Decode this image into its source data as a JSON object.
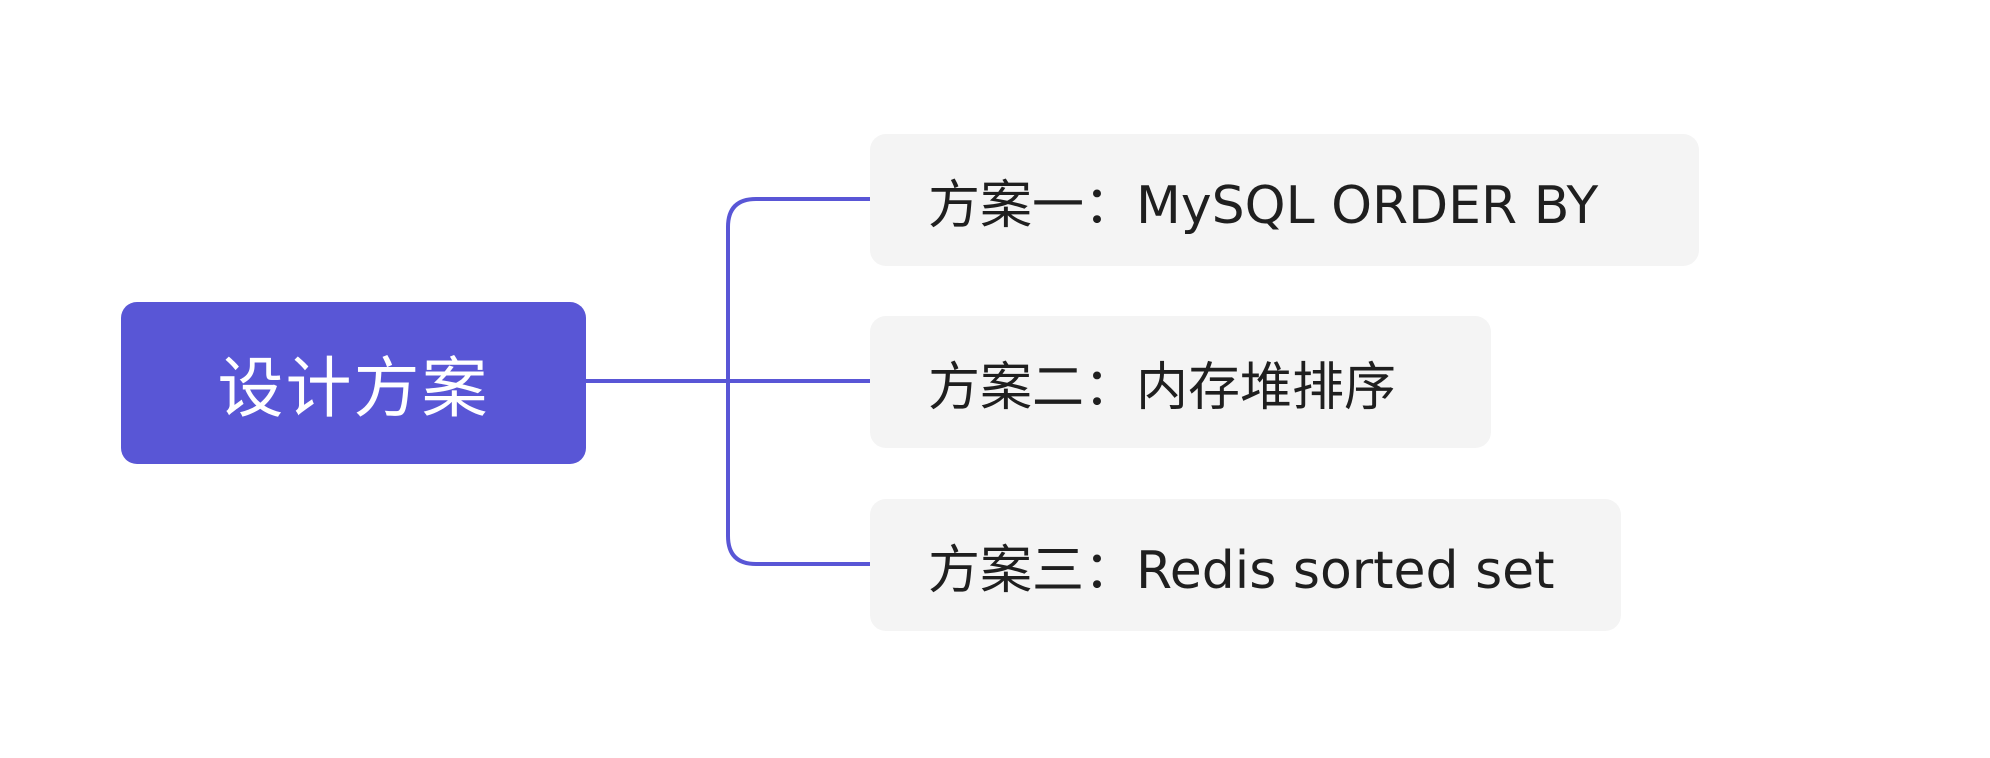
{
  "colors": {
    "accent": "#5956d6",
    "node_bg": "#f4f4f4",
    "connector": "#5956d6"
  },
  "root": {
    "label": "设计方案"
  },
  "children": [
    {
      "label": "方案一：MySQL ORDER BY"
    },
    {
      "label": "方案二：内存堆排序"
    },
    {
      "label": "方案三：Redis sorted set"
    }
  ]
}
